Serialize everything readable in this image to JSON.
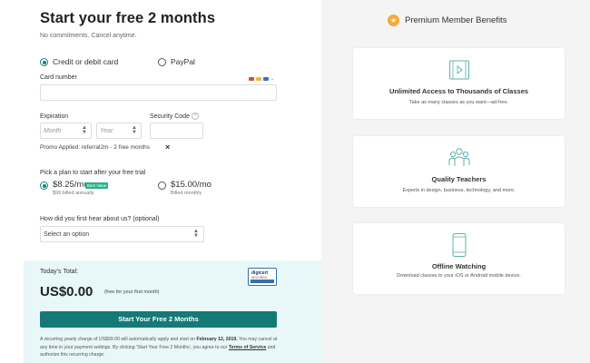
{
  "page": {
    "title": "Start your free 2 months",
    "subtitle": "No commitments. Cancel anytime."
  },
  "payment": {
    "option_card": "Credit or debit card",
    "option_paypal": "PayPal",
    "card_number_label": "Card number",
    "expiration_label": "Expiration",
    "month_placeholder": "Month",
    "year_placeholder": "Year",
    "security_code_label": "Security Code",
    "promo_text": "Promo Applied: referral2m - 2 free months",
    "promo_remove": "×"
  },
  "plans": {
    "heading": "Pick a plan to start after your free trial",
    "annual_price": "$8.25/mo",
    "annual_badge": "Best Value",
    "annual_sub": "$99 billed annually",
    "monthly_price": "$15.00/mo",
    "monthly_sub": "Billed monthly",
    "selected": "annual"
  },
  "survey": {
    "question": "How did you first hear about us? (optional)",
    "select_value": "Select an option"
  },
  "totals": {
    "label": "Today's Total:",
    "amount": "US$0.00",
    "note": "(free for your first month)",
    "badge_name": "digicert",
    "badge_sub": "SECURED",
    "cta": "Start Your Free 2 Months",
    "legal_1": "A recurring yearly charge of US$99.00 will automatically apply and start on ",
    "legal_date": "February 12, 2019.",
    "legal_2": " You may cancel at any time in your payment settings. By clicking 'Start Your Free 2 Months', you agree to our ",
    "legal_tos": "Terms of Service",
    "legal_3": " and authorize this recurring charge."
  },
  "benefits": {
    "title": "Premium Member Benefits",
    "items": [
      {
        "icon": "video-film-icon",
        "title": "Unlimited Access to Thousands of Classes",
        "desc": "Take as many classes as you want—ad-free."
      },
      {
        "icon": "teachers-group-icon",
        "title": "Quality Teachers",
        "desc": "Experts in design, business, technology, and more."
      },
      {
        "icon": "mobile-device-icon",
        "title": "Offline Watching",
        "desc": "Download classes to your iOS or Android mobile device."
      }
    ]
  },
  "colors": {
    "accent": "#157a76",
    "panel_bg": "#f4f4f4",
    "total_bg": "#e8f7f7",
    "star": "#f4a93a",
    "badge_green": "#2ab08a"
  }
}
